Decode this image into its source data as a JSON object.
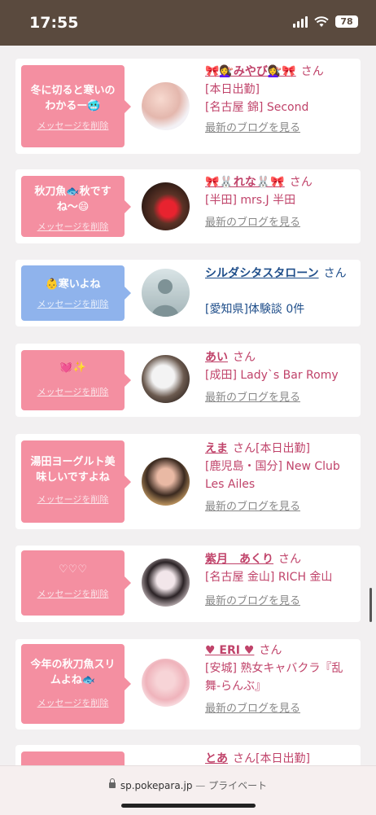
{
  "status_bar": {
    "time": "17:55",
    "battery": "78"
  },
  "messages": [
    {
      "bubble": "冬に切ると寒いのわかるー🥶",
      "delete": "メッセージを削除",
      "bubble_color": "#f48fa1",
      "name": "🎀💇‍♀️みやび💇‍♀️🎀",
      "honorific": "さん",
      "lines": [
        "[本日出勤]",
        "[名古屋 錦] Second"
      ],
      "blog": "最新のブログを見る"
    },
    {
      "bubble": "秋刀魚🐟秋ですね〜😄",
      "delete": "メッセージを削除",
      "bubble_color": "#f48fa1",
      "name": "🎀🐰れな🐰🎀",
      "honorific": "さん",
      "lines": [
        "[半田] mrs.J 半田"
      ],
      "blog": "最新のブログを見る"
    },
    {
      "bubble": "👶寒いよね",
      "delete": "メッセージを削除",
      "bubble_color": "#8fb3ec",
      "name": "シルダシタスタローン",
      "honorific": "さん",
      "lines": [
        "[愛知県]体験談 0件"
      ],
      "blog": "",
      "avatar_text": "no photo"
    },
    {
      "bubble": "💓✨",
      "delete": "メッセージを削除",
      "bubble_color": "#f48fa1",
      "name": "あい",
      "honorific": "さん",
      "lines": [
        "[成田] Lady`s Bar Romy"
      ],
      "blog": "最新のブログを見る"
    },
    {
      "bubble": "湯田ヨーグルト美味しいですよね",
      "delete": "メッセージを削除",
      "bubble_color": "#f48fa1",
      "name": "えま",
      "honorific": "さん",
      "lines": [
        "[本日出勤]",
        "[鹿児島・国分] New Club Les Ailes"
      ],
      "blog": "最新のブログを見る"
    },
    {
      "bubble": "♡♡♡",
      "delete": "メッセージを削除",
      "bubble_color": "#f48fa1",
      "name": "紫月　あくり",
      "honorific": "さん",
      "lines": [
        "[名古屋 金山] RICH 金山"
      ],
      "blog": "最新のブログを見る"
    },
    {
      "bubble": "今年の秋刀魚スリムよね🐟",
      "delete": "メッセージを削除",
      "bubble_color": "#f48fa1",
      "name": "♥ ERI ♥",
      "honorific": "さん",
      "lines": [
        "[安城] 熟女キャバクラ『乱舞-らんぶ』"
      ],
      "blog": "最新のブログを見る"
    },
    {
      "bubble": "",
      "delete": "",
      "bubble_color": "#f48fa1",
      "name": "とあ",
      "honorific": "さん",
      "lines": [
        "[本日出勤]"
      ],
      "blog": ""
    }
  ],
  "url_bar": {
    "domain": "sp.pokepara.jp",
    "separator": "—",
    "mode": "プライベート"
  }
}
